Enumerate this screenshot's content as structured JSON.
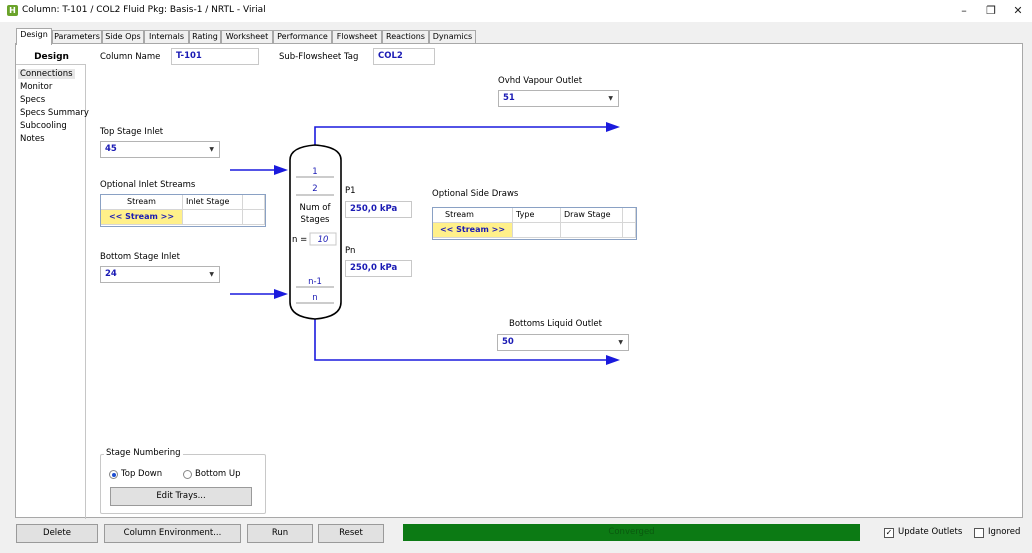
{
  "window": {
    "title": "Column: T-101 / COL2  Fluid Pkg: Basis-1 / NRTL - Virial",
    "app_icon": "H",
    "minimize_glyph": "–",
    "restore_glyph": "❐",
    "close_glyph": "✕"
  },
  "tabs": [
    "Design",
    "Parameters",
    "Side Ops",
    "Internals",
    "Rating",
    "Worksheet",
    "Performance",
    "Flowsheet",
    "Reactions",
    "Dynamics"
  ],
  "active_tab": "Design",
  "nav": {
    "title": "Design",
    "items": [
      "Connections",
      "Monitor",
      "Specs",
      "Specs Summary",
      "Subcooling",
      "Notes"
    ],
    "selected": "Connections"
  },
  "header": {
    "column_name_label": "Column Name",
    "column_name_value": "T-101",
    "subflowsheet_label": "Sub-Flowsheet Tag",
    "subflowsheet_value": "COL2"
  },
  "connections": {
    "ovhd_label": "Ovhd Vapour Outlet",
    "ovhd_value": "51",
    "top_inlet_label": "Top Stage Inlet",
    "top_inlet_value": "45",
    "optional_inlets_label": "Optional Inlet Streams",
    "inlet_table": {
      "headers": [
        "Stream",
        "Inlet Stage",
        ""
      ],
      "placeholder": "<< Stream >>"
    },
    "bottom_inlet_label": "Bottom Stage Inlet",
    "bottom_inlet_value": "24",
    "side_draws_label": "Optional Side Draws",
    "side_table": {
      "headers": [
        "Stream",
        "Type",
        "Draw Stage",
        ""
      ],
      "placeholder": "<< Stream >>"
    },
    "bottoms_label": "Bottoms Liquid Outlet",
    "bottoms_value": "50",
    "p1_label": "P1",
    "p1_value": "250,0 kPa",
    "pn_label": "Pn",
    "pn_value": "250,0 kPa"
  },
  "column": {
    "stage_1": "1",
    "stage_2": "2",
    "num_of": "Num of",
    "stages": "Stages",
    "n_label": "n =",
    "n_value": "10",
    "stage_n_minus_1": "n-1",
    "stage_n": "n",
    "stream_color": "#1a1add"
  },
  "stage_numbering": {
    "title": "Stage Numbering",
    "top_down": "Top Down",
    "bottom_up": "Bottom Up",
    "selected": "Top Down",
    "edit_trays": "Edit Trays..."
  },
  "footer": {
    "delete": "Delete",
    "column_environment": "Column Environment...",
    "run": "Run",
    "reset": "Reset",
    "status": "Converged",
    "status_color": "#0c7a14",
    "update_outlets": "Update Outlets",
    "update_outlets_checked": true,
    "ignored": "Ignored",
    "ignored_checked": false
  }
}
